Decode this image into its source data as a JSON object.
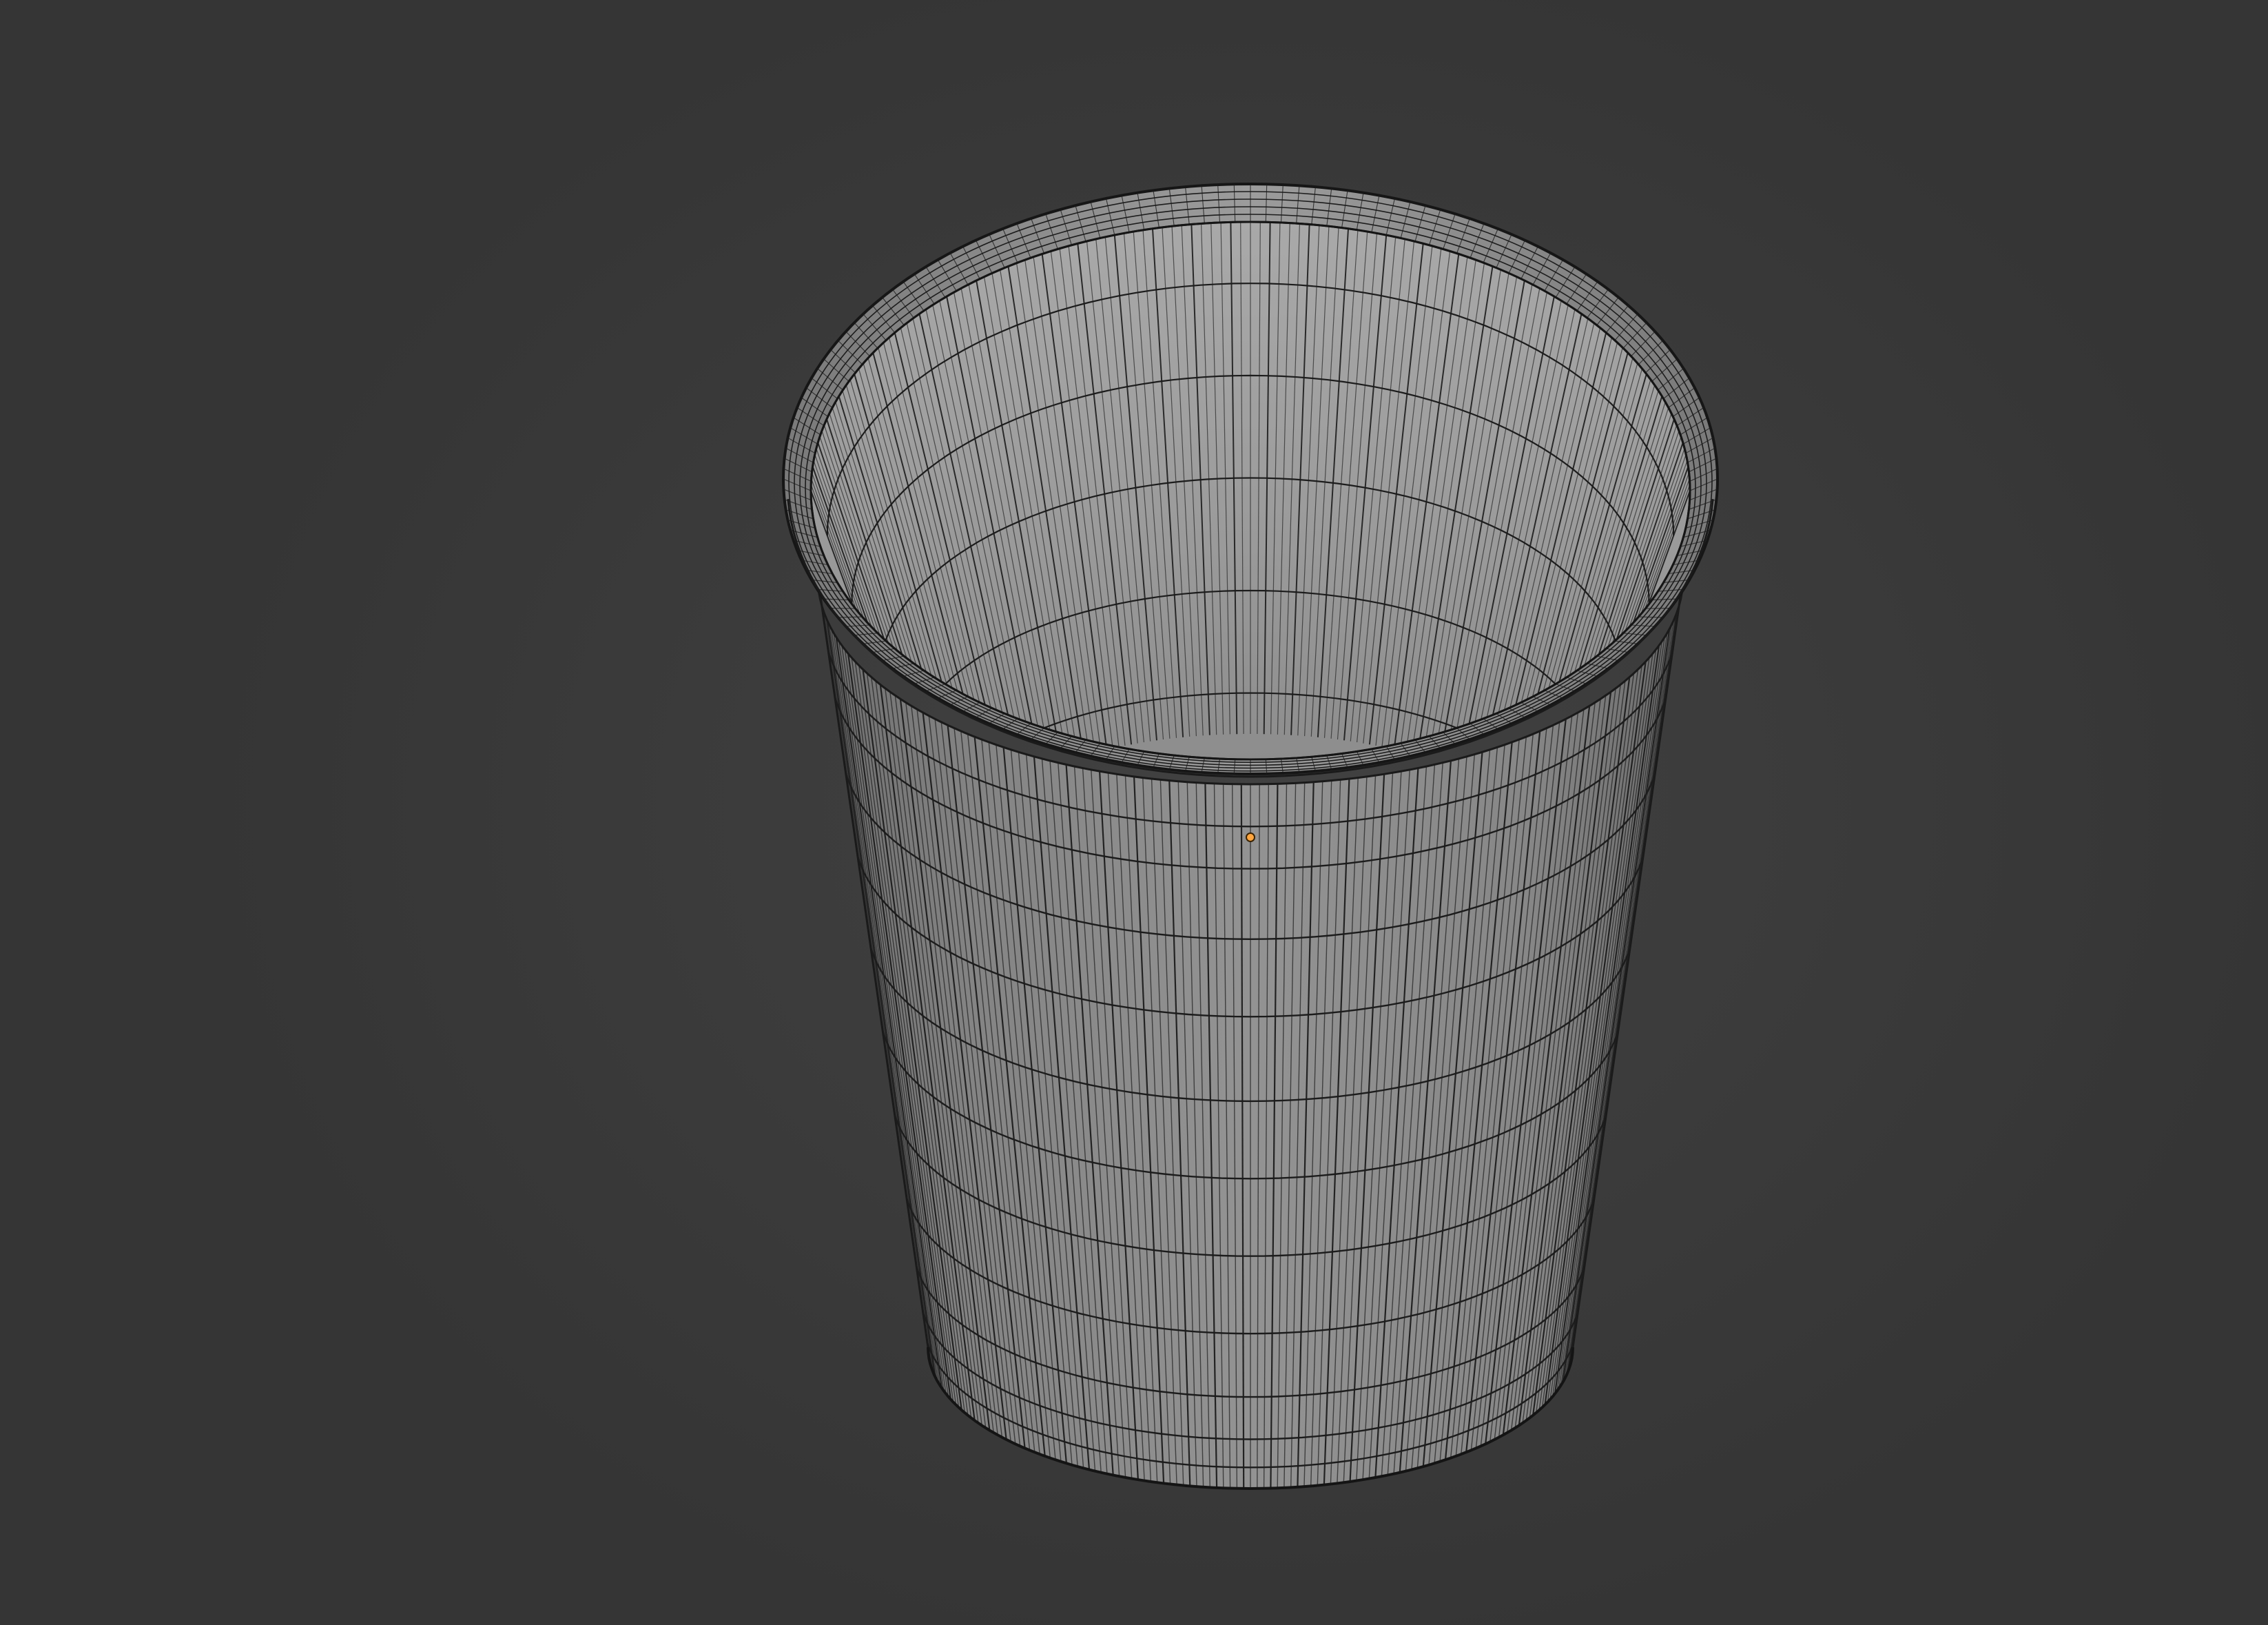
{
  "viewport": {
    "background_color": "#3d3d3d",
    "mode": "3d-viewport-wireframe-overlay"
  },
  "object": {
    "kind": "cup-mesh",
    "mesh_fill_color": "#8e8e8e",
    "interior_color": "#a2a2a2",
    "wire_color": "#1c1c1c",
    "origin_color": "#ffa640"
  }
}
